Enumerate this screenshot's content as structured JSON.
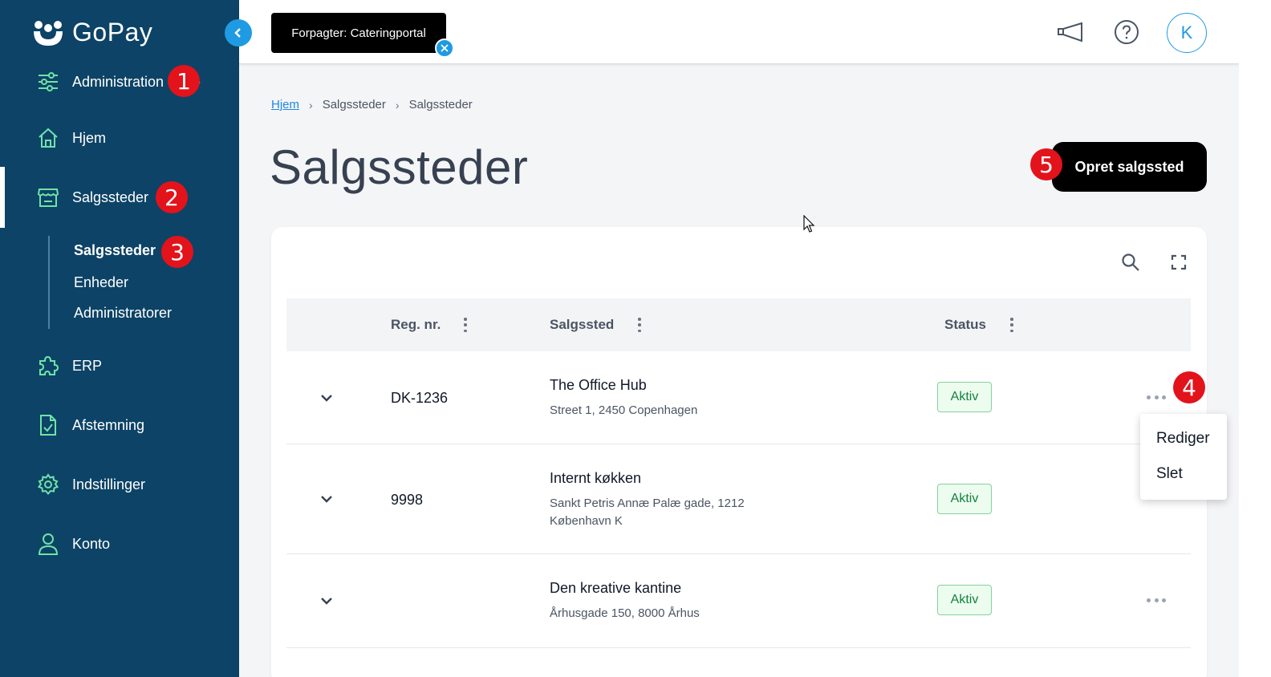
{
  "brand": {
    "name": "GoPay"
  },
  "sidebar": {
    "items": [
      {
        "label": "Administration",
        "icon": "sliders-icon"
      },
      {
        "label": "Hjem",
        "icon": "home-icon"
      },
      {
        "label": "Salgssteder",
        "icon": "store-icon"
      },
      {
        "label": "ERP",
        "icon": "puzzle-icon"
      },
      {
        "label": "Afstemning",
        "icon": "file-check-icon"
      },
      {
        "label": "Indstillinger",
        "icon": "gear-icon"
      },
      {
        "label": "Konto",
        "icon": "user-icon"
      }
    ],
    "subitems": [
      {
        "label": "Salgssteder"
      },
      {
        "label": "Enheder"
      },
      {
        "label": "Administratorer"
      }
    ]
  },
  "topbar": {
    "tenant_chip": "Forpagter: Cateringportal",
    "avatar_initial": "K"
  },
  "breadcrumb": [
    "Hjem",
    "Salgssteder",
    "Salgssteder"
  ],
  "page": {
    "title": "Salgssteder",
    "primary_action": "Opret salgssted"
  },
  "table": {
    "columns": [
      "Reg. nr.",
      "Salgssted",
      "Status"
    ],
    "rows": [
      {
        "reg": "DK-1236",
        "name": "The Office Hub",
        "address_line1": "Street 1, 2450 Copenhagen",
        "address_line2": "",
        "status": "Aktiv"
      },
      {
        "reg": "9998",
        "name": "Internt køkken",
        "address_line1": "Sankt Petris Annæ Palæ gade, 1212",
        "address_line2": "København K",
        "status": "Aktiv"
      },
      {
        "reg": "",
        "name": "Den kreative kantine",
        "address_line1": "Århusgade 150, 8000 Århus",
        "address_line2": "",
        "status": "Aktiv"
      }
    ]
  },
  "context_menu": {
    "items": [
      "Rediger",
      "Slet"
    ]
  },
  "callouts": [
    "1",
    "2",
    "3",
    "4",
    "5"
  ],
  "colors": {
    "sidebar": "#0d4366",
    "accent": "#1e9be3",
    "status_green": "#15803d",
    "callout_red": "#e3131b"
  }
}
